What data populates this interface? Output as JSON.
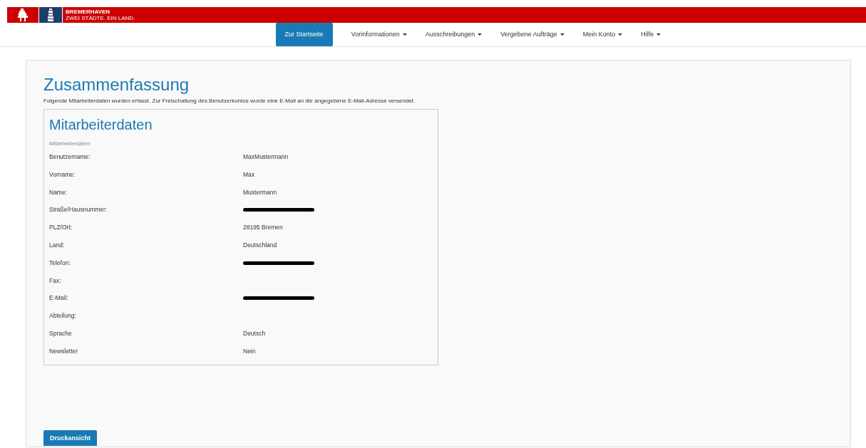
{
  "banner": {
    "line_1": "BREMERHAVEN",
    "line_2": "ZWEI STÄDTE. EIN LAND."
  },
  "nav": [
    {
      "label": "Zur Startseite",
      "selected": true,
      "dropdown": false
    },
    {
      "label": "Vorinformationen",
      "selected": false,
      "dropdown": true
    },
    {
      "label": "Ausschreibungen",
      "selected": false,
      "dropdown": true
    },
    {
      "label": "Vergebene Aufträge",
      "selected": false,
      "dropdown": true
    },
    {
      "label": "Mein Konto",
      "selected": false,
      "dropdown": true
    },
    {
      "label": "Hilfe",
      "selected": false,
      "dropdown": true
    }
  ],
  "title": "Zusammenfassung",
  "intro": "Folgende Mitarbeiterdaten wurden erfasst. Zur Freischaltung des Benutzerkontos wurde eine E-Mail an die angegebene E-Mail-Adresse versendet.",
  "card": {
    "title": "Mitarbeiterdaten",
    "section": "Mitarbeiterdaten",
    "rows": [
      {
        "label": "Benutzername:",
        "value": "MaxMustermann"
      },
      {
        "label": "Vorname:",
        "value": "Max"
      },
      {
        "label": "Name:",
        "value": "Mustermann"
      },
      {
        "label": "Straße/Hausnummer:",
        "kind": "redacted"
      },
      {
        "label": "PLZ/Ort:",
        "value": "28195 Bremen"
      },
      {
        "label": "Land:",
        "value": "Deutschland"
      },
      {
        "label": "Telefon:",
        "kind": "redacted"
      },
      {
        "label": "Fax:"
      },
      {
        "label": "E-Mail:",
        "kind": "redacted"
      },
      {
        "label": "Abteilung:"
      },
      {
        "label": "Sprache",
        "value": "Deutsch"
      },
      {
        "label": "Newsletter",
        "value": "Nein"
      }
    ]
  },
  "print_button": "Druckansicht"
}
